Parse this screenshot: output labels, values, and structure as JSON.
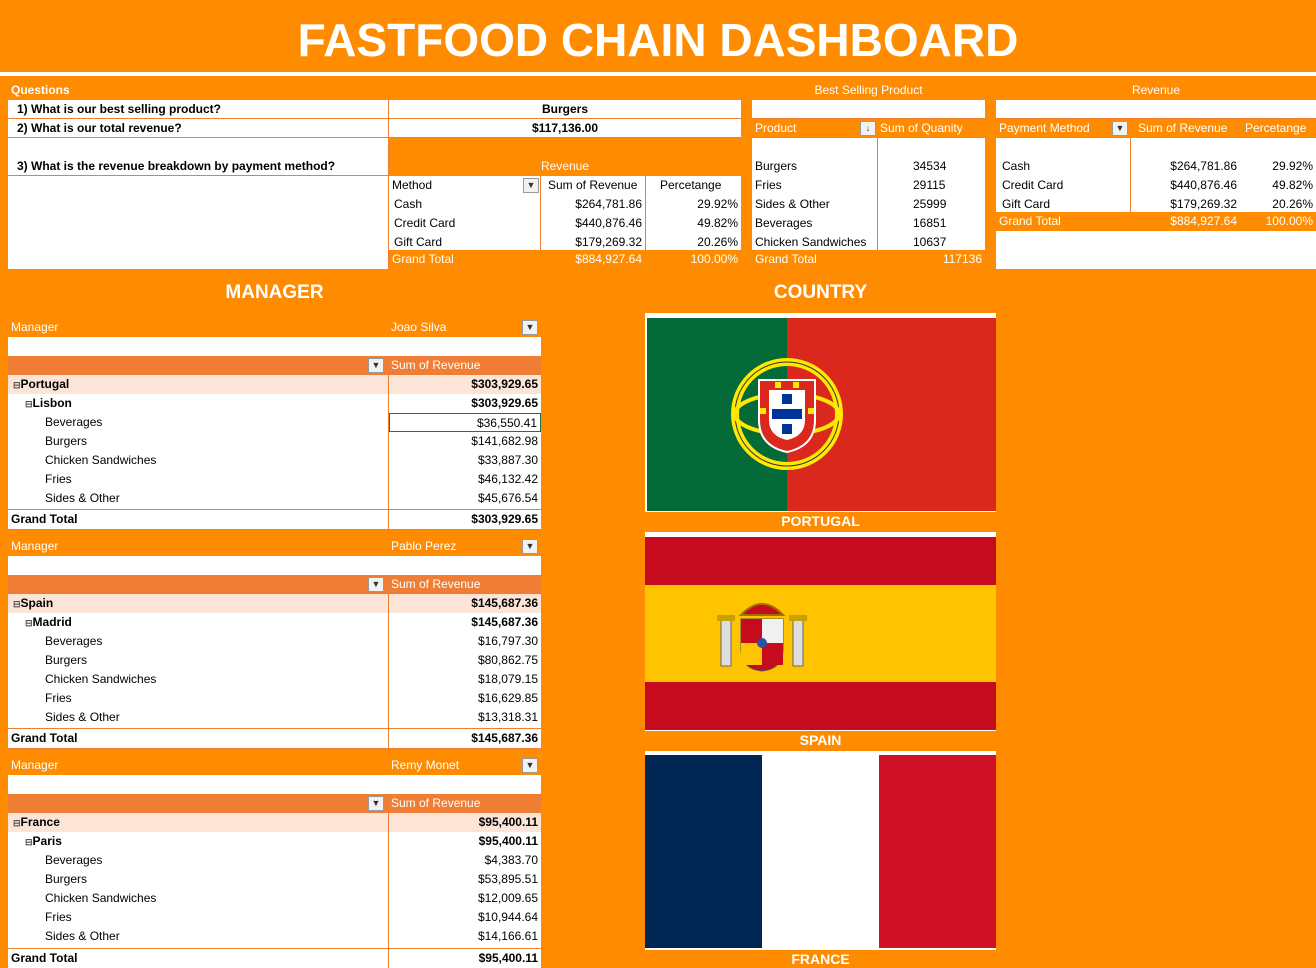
{
  "title": "FASTFOOD CHAIN DASHBOARD",
  "questions": {
    "header": "Questions",
    "q1": "1) What is our best selling product?",
    "a1": "Burgers",
    "q2": "2) What is our total revenue?",
    "a2": "$117,136.00",
    "q3": "3) What is the revenue breakdown by payment method?",
    "table_title": "Revenue",
    "col_method": "Method",
    "col_sum": "Sum of Revenue",
    "col_pct": "Percetange",
    "rows": [
      {
        "method": "Cash",
        "sum": "$264,781.86",
        "pct": "29.92%"
      },
      {
        "method": "Credit Card",
        "sum": "$440,876.46",
        "pct": "49.82%"
      },
      {
        "method": "Gift Card",
        "sum": "$179,269.32",
        "pct": "20.26%"
      }
    ],
    "total_label": "Grand Total",
    "total_sum": "$884,927.64",
    "total_pct": "100.00%"
  },
  "best_selling": {
    "header": "Best Selling Product",
    "col_product": "Product",
    "col_qty": "Sum of Quanity",
    "rows": [
      {
        "product": "Burgers",
        "qty": "34534"
      },
      {
        "product": "Fries",
        "qty": "29115"
      },
      {
        "product": "Sides & Other",
        "qty": "25999"
      },
      {
        "product": "Beverages",
        "qty": "16851"
      },
      {
        "product": "Chicken Sandwiches",
        "qty": "10637"
      }
    ],
    "total_label": "Grand Total",
    "total_qty": "117136"
  },
  "revenue": {
    "header": "Revenue",
    "col_method": "Payment Method",
    "col_sum": "Sum of Revenue",
    "col_pct": "Percetange",
    "rows": [
      {
        "method": "Cash",
        "sum": "$264,781.86",
        "pct": "29.92%"
      },
      {
        "method": "Credit Card",
        "sum": "$440,876.46",
        "pct": "49.82%"
      },
      {
        "method": "Gift Card",
        "sum": "$179,269.32",
        "pct": "20.26%"
      }
    ],
    "total_label": "Grand Total",
    "total_sum": "$884,927.64",
    "total_pct": "100.00%"
  },
  "manager_section": "MANAGER",
  "country_section": "COUNTRY",
  "managers": [
    {
      "label": "Manager",
      "name": "Joao Silva",
      "sum_header": "Sum of Revenue",
      "country": "Portugal",
      "country_total": "$303,929.65",
      "city": "Lisbon",
      "city_total": "$303,929.65",
      "items": [
        {
          "name": "Beverages",
          "value": "$36,550.41"
        },
        {
          "name": "Burgers",
          "value": "$141,682.98"
        },
        {
          "name": "Chicken Sandwiches",
          "value": "$33,887.30"
        },
        {
          "name": "Fries",
          "value": "$46,132.42"
        },
        {
          "name": "Sides & Other",
          "value": "$45,676.54"
        }
      ],
      "total_label": "Grand Total",
      "total": "$303,929.65"
    },
    {
      "label": "Manager",
      "name": "Pablo Perez",
      "sum_header": "Sum of Revenue",
      "country": "Spain",
      "country_total": "$145,687.36",
      "city": "Madrid",
      "city_total": "$145,687.36",
      "items": [
        {
          "name": "Beverages",
          "value": "$16,797.30"
        },
        {
          "name": "Burgers",
          "value": "$80,862.75"
        },
        {
          "name": "Chicken Sandwiches",
          "value": "$18,079.15"
        },
        {
          "name": "Fries",
          "value": "$16,629.85"
        },
        {
          "name": "Sides & Other",
          "value": "$13,318.31"
        }
      ],
      "total_label": "Grand Total",
      "total": "$145,687.36"
    },
    {
      "label": "Manager",
      "name": "Remy Monet",
      "sum_header": "Sum of Revenue",
      "country": "France",
      "country_total": "$95,400.11",
      "city": "Paris",
      "city_total": "$95,400.11",
      "items": [
        {
          "name": "Beverages",
          "value": "$4,383.70"
        },
        {
          "name": "Burgers",
          "value": "$53,895.51"
        },
        {
          "name": "Chicken Sandwiches",
          "value": "$12,009.65"
        },
        {
          "name": "Fries",
          "value": "$10,944.64"
        },
        {
          "name": "Sides & Other",
          "value": "$14,166.61"
        }
      ],
      "total_label": "Grand Total",
      "total": "$95,400.11"
    }
  ],
  "flags": {
    "portugal": "PORTUGAL",
    "spain": "SPAIN",
    "france": "FRANCE"
  },
  "colors": {
    "accent": "#ff8c00",
    "pivot_header": "#ef7d33",
    "portugal_green": "#046a38",
    "portugal_red": "#da291c",
    "spain_red": "#c60b1e",
    "spain_yellow": "#ffc400",
    "france_blue": "#002654",
    "france_red": "#ce1126"
  }
}
